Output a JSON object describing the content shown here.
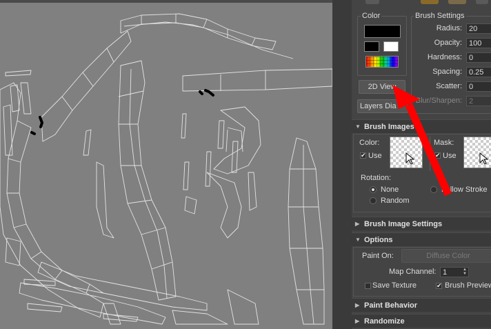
{
  "panel": {
    "color_group": {
      "label": "Color"
    },
    "brush_settings": {
      "label": "Brush Settings",
      "rows": [
        {
          "label": "Radius:",
          "value": "20"
        },
        {
          "label": "Opacity:",
          "value": "100"
        },
        {
          "label": "Hardness:",
          "value": "0"
        },
        {
          "label": "Spacing:",
          "value": "0.25"
        },
        {
          "label": "Scatter:",
          "value": "0"
        },
        {
          "label": "Blur/Sharpen:",
          "value": "2"
        }
      ]
    },
    "buttons": {
      "view_2d": "2D View",
      "layers": "Layers Dia"
    },
    "brush_images": {
      "header": "Brush Images",
      "color_label": "Color:",
      "mask_label": "Mask:",
      "use_label": "Use",
      "rotation_label": "Rotation:",
      "rotation_options": [
        "None",
        "Follow Stroke",
        "Random"
      ],
      "rotation_selected": "None"
    },
    "brush_image_settings": {
      "header": "Brush Image Settings"
    },
    "options": {
      "header": "Options",
      "paint_on_label": "Paint On:",
      "paint_on_value": "Diffuse Color",
      "map_channel_label": "Map Channel:",
      "map_channel_value": "1",
      "save_texture": "Save Texture",
      "brush_preview": "Brush Preview"
    },
    "paint_behavior": {
      "header": "Paint Behavior"
    },
    "randomize": {
      "header": "Randomize"
    }
  },
  "colors": {
    "viewport_bg": "#808080",
    "uv_lines": "#e0e0e0",
    "panel_bg": "#444444",
    "annotation_arrow": "#ff0000"
  },
  "icons": [
    "cursor-arrow-icon",
    "checkbox-check-icon",
    "collapse-triangle-icon",
    "spinner-arrows-icon"
  ]
}
